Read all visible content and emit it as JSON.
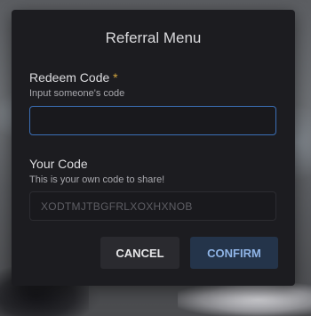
{
  "modal": {
    "title": "Referral Menu"
  },
  "redeem": {
    "label": "Redeem Code",
    "required_mark": "*",
    "hint": "Input someone's code",
    "value": ""
  },
  "own_code": {
    "label": "Your Code",
    "hint": "This is your own code to share!",
    "value": "XODTMJTBGFRLXOXHXNOB"
  },
  "actions": {
    "cancel_label": "CANCEL",
    "confirm_label": "CONFIRM"
  },
  "colors": {
    "modal_background": "#1c1c20",
    "focus_border": "#3b6fb6",
    "required_mark": "#d0a33e",
    "confirm_text": "#8fb4e6"
  }
}
